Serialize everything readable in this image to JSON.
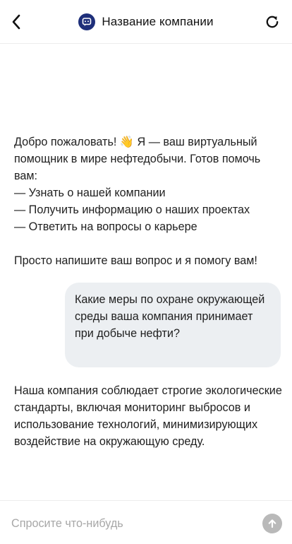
{
  "header": {
    "title": "Название компании",
    "icons": {
      "back": "chevron-left-icon",
      "logo": "chat-bot-icon",
      "refresh": "refresh-icon"
    },
    "logo_color": "#1e2f7a"
  },
  "messages": [
    {
      "role": "assistant",
      "text": "Добро пожаловать! 👋 Я — ваш виртуальный помощник в мире нефтедобычи. Готов помочь вам:\n— Узнать о нашей компании\n— Получить информацию о наших проектах\n— Ответить на вопросы о карьере\n\nПросто напишите ваш вопрос и я помогу вам!"
    },
    {
      "role": "user",
      "text": "Какие меры по охране окружающей среды ваша компания принимает при добыче нефти?"
    },
    {
      "role": "assistant",
      "text": "Наша компания соблюдает строгие экологические стандарты, включая мониторинг выбросов и использование технологий, минимизирующих воздействие на окружающую среду."
    }
  ],
  "composer": {
    "placeholder": "Спросите что-нибудь",
    "value": "",
    "send_icon": "arrow-up-icon",
    "send_color": "#b9b9b9"
  },
  "colors": {
    "user_bubble": "#eceff2",
    "text": "#1f1f1f",
    "divider": "#ececec"
  }
}
